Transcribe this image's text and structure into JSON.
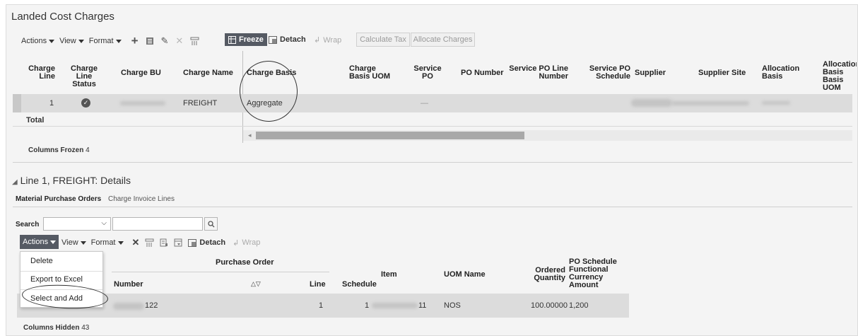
{
  "landed": {
    "title": "Landed Cost Charges",
    "toolbar": {
      "actions": "Actions",
      "view": "View",
      "format": "Format",
      "freeze": "Freeze",
      "detach": "Detach",
      "wrap": "Wrap",
      "calculate_tax": "Calculate Tax",
      "allocate_charges": "Allocate Charges"
    },
    "columns": {
      "charge_line": "Charge Line",
      "charge_line_status": "Charge Line Status",
      "charge_bu": "Charge BU",
      "charge_name": "Charge Name",
      "charge_basis": "Charge Basis",
      "charge_basis_uom": "Charge Basis UOM",
      "service_po": "Service PO",
      "po_number": "PO Number",
      "service_po_line_number": "Service PO Line Number",
      "service_po_schedule": "Service PO Schedule",
      "supplier": "Supplier",
      "supplier_site": "Supplier Site",
      "allocation_basis": "Allocation Basis",
      "allocation_basis_uom": "Allocation Basis Basis UOM"
    },
    "row": {
      "charge_line": "1",
      "charge_name": "FREIGHT",
      "charge_basis": "Aggregate",
      "service_po": "—"
    },
    "total_label": "Total",
    "columns_frozen_label": "Columns Frozen",
    "columns_frozen_value": "4"
  },
  "details": {
    "title": "Line 1, FREIGHT: Details",
    "tabs": [
      "Material Purchase Orders",
      "Charge Invoice Lines"
    ],
    "search_label": "Search",
    "toolbar": {
      "actions": "Actions",
      "view": "View",
      "format": "Format",
      "detach": "Detach",
      "wrap": "Wrap"
    },
    "columns": {
      "purchase_order": "Purchase Order",
      "number": "Number",
      "line": "Line",
      "schedule": "Schedule",
      "item": "Item",
      "uom_name": "UOM Name",
      "ordered_quantity": "Ordered Quantity",
      "po_schedule_amount": "PO Schedule Functional Currency Amount"
    },
    "row": {
      "number": "122",
      "line": "1",
      "schedule": "1",
      "item": "11",
      "uom_name": "NOS",
      "ordered_quantity": "100.00000",
      "amount": "1,200"
    },
    "menu": [
      "Delete",
      "Export to Excel",
      "Select and Add"
    ],
    "columns_hidden_label": "Columns Hidden",
    "columns_hidden_value": "43"
  },
  "colors": {
    "freeze_bg": "#555a63",
    "row_bg": "#dcdcdc",
    "panel_bg": "#f4f4f4"
  }
}
